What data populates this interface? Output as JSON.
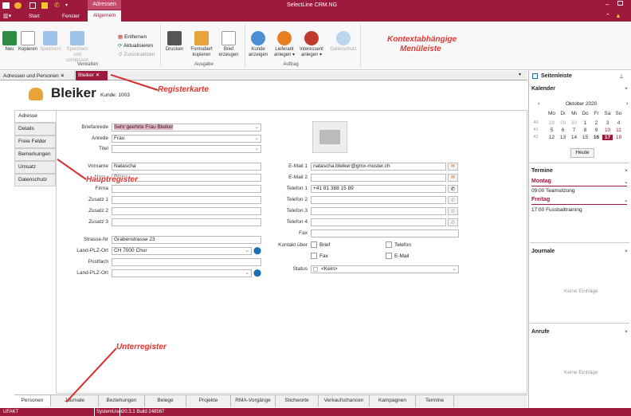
{
  "window": {
    "title": "SelectLine CRM.NG",
    "tab_context": "Adressen"
  },
  "menu": {
    "start": "Start",
    "fenster": "Fenster",
    "allgemein": "Allgemein"
  },
  "ribbon": {
    "neu": "Neu",
    "kopieren": "Kopieren",
    "speichern": "Speichern",
    "speichern_schliessen_1": "Speichern und",
    "speichern_schliessen_2": "schliessen",
    "entfernen": "Entfernen",
    "aktualisieren": "Aktualisieren",
    "zuruecksetzen": "Zurücksetzen",
    "verwalten": "Verwalten",
    "drucken": "Drucken",
    "formatiert_1": "Formatiert",
    "formatiert_2": "kopieren",
    "brief_1": "Brief",
    "brief_2": "erzeugen",
    "ausgabe": "Ausgabe",
    "kunde_1": "Kunde",
    "kunde_2": "anzeigen",
    "lieferant_1": "Lieferant",
    "lieferant_2": "anlegen ▾",
    "interessent_1": "Interessent",
    "interessent_2": "anlegen ▾",
    "datenschutz": "Datenschutz",
    "auftrag": "Auftrag"
  },
  "doc_tabs": {
    "adressen": "Adressen und Personen",
    "bleiker": "Bleiker"
  },
  "header": {
    "name": "Bleiker",
    "kunde": "Kunde: 1003"
  },
  "nav": [
    "Adresse",
    "Details",
    "Freie Felder",
    "Bemerkungen",
    "Umsatz",
    "Datenschutz"
  ],
  "form": {
    "briefanrede_label": "Briefanrede",
    "briefanrede": "Sehr geehrte Frau Bleiker",
    "anrede_label": "Anrede",
    "anrede": "Frau",
    "titel_label": "Titel",
    "vorname_label": "Vorname",
    "vorname": "Natascha",
    "name_label": "Name",
    "name": "Bleiker",
    "firma_label": "Firma",
    "zusatz1_label": "Zusatz 1",
    "zusatz2_label": "Zusatz 2",
    "zusatz3_label": "Zusatz 3",
    "strasse_label": "Strasse-Nr",
    "strasse": "Grabenstrasse 23",
    "plz_label": "Land-PLZ-Ort",
    "plz": "CH 7000 Chur",
    "postfach_label": "Postfach",
    "plz2_label": "Land-PLZ-Ort",
    "email1_label": "E-Mail 1",
    "email1": "natascha.bleiker@gmx-muster.ch",
    "email2_label": "E-Mail 2",
    "tel1_label": "Telefon 1",
    "tel1": "+41 81 388 15 89",
    "tel2_label": "Telefon 2",
    "tel3_label": "Telefon 3",
    "tel4_label": "Telefon 4",
    "fax_label": "Fax",
    "kontakt_label": "Kontakt über",
    "brief": "Brief",
    "telefon": "Telefon",
    "fax": "Fax",
    "email": "E-Mail",
    "status_label": "Status",
    "status": "<Kein>"
  },
  "bottom_tabs": [
    "Personen",
    "Journale",
    "Beziehungen",
    "Belege",
    "Projekte",
    "RMA-Vorgänge",
    "Stichworte",
    "Verkaufschancen",
    "Kampagnen",
    "Termine"
  ],
  "sidebar": {
    "title": "Seitenleiste",
    "kalender": "Kalender",
    "month": "Oktober 2020",
    "days": [
      "Mo",
      "Di",
      "Mi",
      "Do",
      "Fr",
      "Sa",
      "So"
    ],
    "weeks": [
      {
        "kw": "40",
        "d": [
          "28",
          "29",
          "30",
          "1",
          "2",
          "3",
          "4"
        ]
      },
      {
        "kw": "41",
        "d": [
          "5",
          "6",
          "7",
          "8",
          "9",
          "10",
          "11"
        ]
      },
      {
        "kw": "42",
        "d": [
          "12",
          "13",
          "14",
          "15",
          "16",
          "17",
          "18"
        ]
      }
    ],
    "heute": "Heute",
    "termine": "Termine",
    "montag": "Montag",
    "montag_item": "09:00 Teamsitzung",
    "freitag": "Freitag",
    "freitag_item": "17:00 Fussballtraining",
    "journale": "Journale",
    "keine1": "Keine Einträge",
    "anrufe": "Anrufe",
    "keine2": "Keine Einträge"
  },
  "status": {
    "ufakt": "UFAKT",
    "user": "SystemUser",
    "build": "20.3.1 Build 248567"
  },
  "annotations": {
    "kontext": "Kontextabhängige",
    "menueleiste": "Menüleiste",
    "registerkarte": "Registerkarte",
    "hauptregister": "Hauptregister",
    "unterregister": "Unterregister"
  }
}
